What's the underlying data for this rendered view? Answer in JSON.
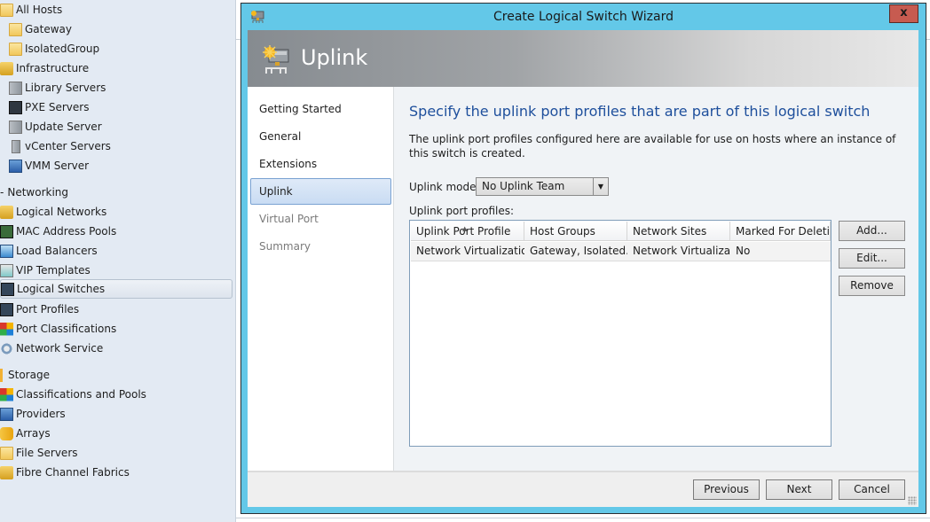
{
  "nav": {
    "items": [
      {
        "label": "All Hosts",
        "icon": "folder-icon"
      },
      {
        "label": "Gateway",
        "icon": "folder-icon"
      },
      {
        "label": "IsolatedGroup",
        "icon": "folder-icon"
      },
      {
        "label": "Infrastructure",
        "icon": "infrastructure-icon"
      },
      {
        "label": "Library Servers",
        "icon": "library-server-icon"
      },
      {
        "label": "PXE Servers",
        "icon": "pxe-server-icon"
      },
      {
        "label": "Update Server",
        "icon": "update-server-icon"
      },
      {
        "label": "vCenter Servers",
        "icon": "vcenter-server-icon"
      },
      {
        "label": "VMM Server",
        "icon": "vmm-server-icon"
      },
      {
        "label": "Networking",
        "icon": "collapse-icon"
      },
      {
        "label": "Logical Networks",
        "icon": "logical-network-icon"
      },
      {
        "label": "MAC Address Pools",
        "icon": "mac-pool-icon"
      },
      {
        "label": "Load Balancers",
        "icon": "load-balancer-icon"
      },
      {
        "label": "VIP Templates",
        "icon": "vip-template-icon"
      },
      {
        "label": "Logical Switches",
        "icon": "logical-switch-icon",
        "selected": true
      },
      {
        "label": "Port Profiles",
        "icon": "port-profile-icon"
      },
      {
        "label": "Port Classifications",
        "icon": "port-classification-icon"
      },
      {
        "label": "Network Service",
        "icon": "network-service-icon"
      },
      {
        "label": "Storage",
        "icon": "storage-icon"
      },
      {
        "label": "Classifications and Pools",
        "icon": "classification-icon"
      },
      {
        "label": "Providers",
        "icon": "provider-icon"
      },
      {
        "label": "Arrays",
        "icon": "array-icon"
      },
      {
        "label": "File Servers",
        "icon": "file-server-icon"
      },
      {
        "label": "Fibre Channel Fabrics",
        "icon": "fibre-channel-icon"
      }
    ]
  },
  "dialog": {
    "title": "Create Logical Switch Wizard",
    "close_label": "x",
    "banner_title": "Uplink",
    "steps": [
      {
        "label": "Getting Started",
        "state": "done"
      },
      {
        "label": "General",
        "state": "done"
      },
      {
        "label": "Extensions",
        "state": "done"
      },
      {
        "label": "Uplink",
        "state": "active"
      },
      {
        "label": "Virtual Port",
        "state": "disabled"
      },
      {
        "label": "Summary",
        "state": "disabled"
      }
    ],
    "heading": "Specify the uplink port profiles that are part of this logical switch",
    "description": "The uplink port profiles configured here are available for use on hosts where an instance of this switch is created.",
    "uplink_mode_label": "Uplink mode:",
    "uplink_mode_value": "No Uplink Team",
    "profiles_label": "Uplink port profiles:",
    "grid": {
      "columns": [
        "Uplink Port Profile",
        "Host Groups",
        "Network Sites",
        "Marked For Deleti..."
      ],
      "rows": [
        [
          "Network Virtualization",
          "Gateway, Isolated...",
          "Network Virtualiza...",
          "No"
        ]
      ]
    },
    "buttons": {
      "add": "Add...",
      "edit": "Edit...",
      "remove": "Remove",
      "previous": "Previous",
      "next": "Next",
      "cancel": "Cancel"
    }
  }
}
